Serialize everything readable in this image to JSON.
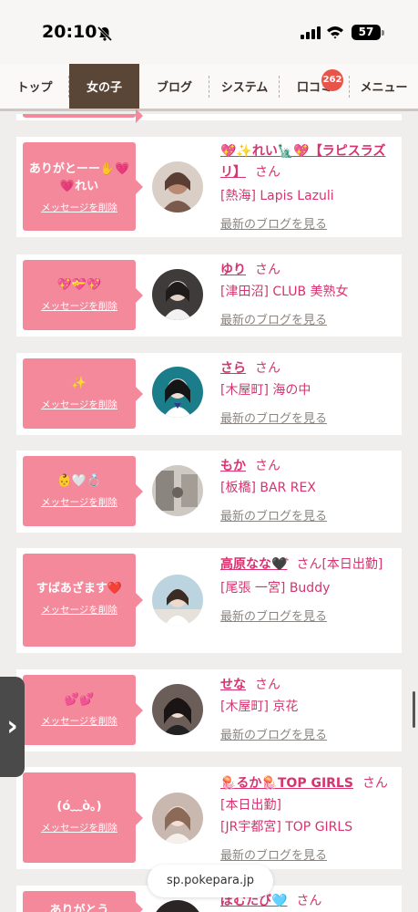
{
  "status": {
    "time": "20:10",
    "battery": "57"
  },
  "nav": {
    "tabs": [
      {
        "label": "トップ"
      },
      {
        "label": "女の子"
      },
      {
        "label": "ブログ"
      },
      {
        "label": "システム"
      },
      {
        "label": "口コミ"
      },
      {
        "label": "メニュー"
      }
    ],
    "review_badge": "262"
  },
  "cards": [
    {
      "message": "ありがとーー✋💗💗れい",
      "delete_label": "メッセージを削除",
      "name": "💖✨れい🗽💖【ラピスラズリ】",
      "honorific": "さん",
      "shop": "[熱海] Lapis Lazuli",
      "blog_link": "最新のブログを見る"
    },
    {
      "message": "💖💝💖",
      "delete_label": "メッセージを削除",
      "name": "ゆり",
      "honorific": "さん",
      "shop": "[津田沼] CLUB 美熟女",
      "blog_link": "最新のブログを見る"
    },
    {
      "message": "✨",
      "delete_label": "メッセージを削除",
      "name": "さら",
      "honorific": "さん",
      "shop": "[木屋町] 海の中",
      "blog_link": "最新のブログを見る"
    },
    {
      "message": "👶🤍💍",
      "delete_label": "メッセージを削除",
      "name": "もか",
      "honorific": "さん",
      "shop": "[板橋] BAR REX",
      "blog_link": "最新のブログを見る"
    },
    {
      "message": "すばあざます❤️",
      "delete_label": "メッセージを削除",
      "name": "高原なな🖤͛",
      "honorific": "さん",
      "extra": "[本日出勤]",
      "shop": "[尾張 一宮] Buddy",
      "blog_link": "最新のブログを見る"
    },
    {
      "message": "💕💕",
      "delete_label": "メッセージを削除",
      "name": "せな",
      "honorific": "さん",
      "shop": "[木屋町] 京花",
      "blog_link": "最新のブログを見る"
    },
    {
      "message": "(ó﹏ò｡)",
      "delete_label": "メッセージを削除",
      "name": "🪼るか🪼TOP GIRLS",
      "honorific": "さん",
      "extra": "[本日出勤]",
      "shop": "[JR宇都宮] TOP GIRLS",
      "blog_link": "最新のブログを見る"
    },
    {
      "message": "ありがとう",
      "name": "ぽむたび🩵",
      "honorific": "さん"
    }
  ],
  "url": "sp.pokepara.jp",
  "colors": {
    "accent": "#d6336f",
    "bubble": "#f4899c",
    "nav_active": "#5a4637",
    "badge": "#e8534a"
  }
}
